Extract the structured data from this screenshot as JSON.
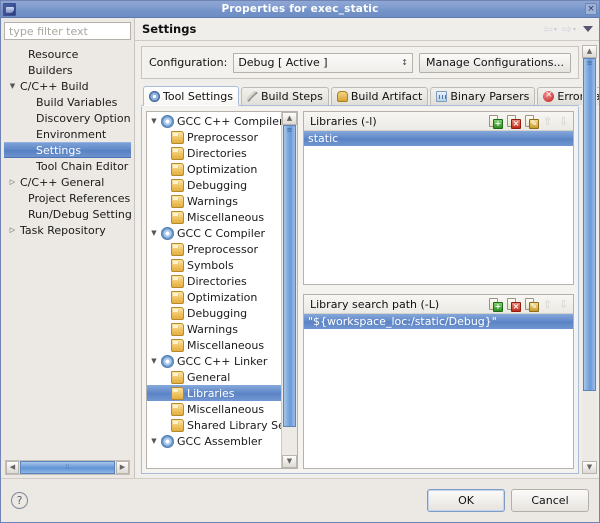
{
  "window": {
    "title": "Properties for exec_static",
    "icon": "eclipse-icon",
    "close_label": "×"
  },
  "sidebar": {
    "filter_placeholder": "type filter text",
    "filter_value": "",
    "items": [
      {
        "label": "Resource",
        "indent": 1,
        "twisty": "",
        "selected": false
      },
      {
        "label": "Builders",
        "indent": 1,
        "twisty": "",
        "selected": false
      },
      {
        "label": "C/C++ Build",
        "indent": 0,
        "twisty": "▼",
        "selected": false
      },
      {
        "label": "Build Variables",
        "indent": 2,
        "twisty": "",
        "selected": false
      },
      {
        "label": "Discovery Options",
        "indent": 2,
        "twisty": "",
        "selected": false
      },
      {
        "label": "Environment",
        "indent": 2,
        "twisty": "",
        "selected": false
      },
      {
        "label": "Settings",
        "indent": 2,
        "twisty": "",
        "selected": true
      },
      {
        "label": "Tool Chain Editor",
        "indent": 2,
        "twisty": "",
        "selected": false
      },
      {
        "label": "C/C++ General",
        "indent": 0,
        "twisty": "▷",
        "selected": false
      },
      {
        "label": "Project References",
        "indent": 1,
        "twisty": "",
        "selected": false
      },
      {
        "label": "Run/Debug Settings",
        "indent": 1,
        "twisty": "",
        "selected": false
      },
      {
        "label": "Task Repository",
        "indent": 0,
        "twisty": "▷",
        "selected": false
      }
    ],
    "hscroll": {
      "left_arrow": "◀",
      "right_arrow": "▶",
      "grip": "∶∶"
    }
  },
  "page": {
    "title": "Settings",
    "back_arrow": "⇦",
    "forward_arrow": "⇨",
    "caret": "▾",
    "menu": "menu-triangle"
  },
  "config": {
    "label": "Configuration:",
    "value": "Debug  [ Active ]",
    "combo_arrows": "↕",
    "manage_button": "Manage Configurations..."
  },
  "tabs": [
    {
      "label": "Tool Settings",
      "icon": "gear-icon",
      "active": true
    },
    {
      "label": "Build Steps",
      "icon": "wrench-icon",
      "active": false
    },
    {
      "label": "Build Artifact",
      "icon": "artifact-icon",
      "active": false
    },
    {
      "label": "Binary Parsers",
      "icon": "binary-icon",
      "active": false
    },
    {
      "label": "Error Parsers",
      "icon": "error-icon",
      "active": false
    }
  ],
  "tool_tree": [
    {
      "label": "GCC C++ Compiler",
      "icon": "compiler-icon",
      "twisty": "▼",
      "indent": 0,
      "selected": false
    },
    {
      "label": "Preprocessor",
      "icon": "folder-icon",
      "twisty": "",
      "indent": 1,
      "selected": false
    },
    {
      "label": "Directories",
      "icon": "folder-icon",
      "twisty": "",
      "indent": 1,
      "selected": false
    },
    {
      "label": "Optimization",
      "icon": "folder-icon",
      "twisty": "",
      "indent": 1,
      "selected": false
    },
    {
      "label": "Debugging",
      "icon": "folder-icon",
      "twisty": "",
      "indent": 1,
      "selected": false
    },
    {
      "label": "Warnings",
      "icon": "folder-icon",
      "twisty": "",
      "indent": 1,
      "selected": false
    },
    {
      "label": "Miscellaneous",
      "icon": "folder-icon",
      "twisty": "",
      "indent": 1,
      "selected": false
    },
    {
      "label": "GCC C Compiler",
      "icon": "compiler-icon",
      "twisty": "▼",
      "indent": 0,
      "selected": false
    },
    {
      "label": "Preprocessor",
      "icon": "folder-icon",
      "twisty": "",
      "indent": 1,
      "selected": false
    },
    {
      "label": "Symbols",
      "icon": "folder-icon",
      "twisty": "",
      "indent": 1,
      "selected": false
    },
    {
      "label": "Directories",
      "icon": "folder-icon",
      "twisty": "",
      "indent": 1,
      "selected": false
    },
    {
      "label": "Optimization",
      "icon": "folder-icon",
      "twisty": "",
      "indent": 1,
      "selected": false
    },
    {
      "label": "Debugging",
      "icon": "folder-icon",
      "twisty": "",
      "indent": 1,
      "selected": false
    },
    {
      "label": "Warnings",
      "icon": "folder-icon",
      "twisty": "",
      "indent": 1,
      "selected": false
    },
    {
      "label": "Miscellaneous",
      "icon": "folder-icon",
      "twisty": "",
      "indent": 1,
      "selected": false
    },
    {
      "label": "GCC C++ Linker",
      "icon": "compiler-icon",
      "twisty": "▼",
      "indent": 0,
      "selected": false
    },
    {
      "label": "General",
      "icon": "folder-icon",
      "twisty": "",
      "indent": 1,
      "selected": false
    },
    {
      "label": "Libraries",
      "icon": "folder-icon",
      "twisty": "",
      "indent": 1,
      "selected": true
    },
    {
      "label": "Miscellaneous",
      "icon": "folder-icon",
      "twisty": "",
      "indent": 1,
      "selected": false
    },
    {
      "label": "Shared Library Settings",
      "icon": "folder-icon",
      "twisty": "",
      "indent": 1,
      "selected": false
    },
    {
      "label": "GCC Assembler",
      "icon": "compiler-icon",
      "twisty": "▼",
      "indent": 0,
      "selected": false
    }
  ],
  "libraries_panel": {
    "title": "Libraries (-l)",
    "items": [
      {
        "label": "static",
        "selected": true
      }
    ],
    "tools": [
      {
        "name": "add-button",
        "badge": "+",
        "kind": "add"
      },
      {
        "name": "delete-button",
        "badge": "×",
        "kind": "del"
      },
      {
        "name": "edit-button",
        "badge": "✎",
        "kind": "edit"
      },
      {
        "name": "move-up-button",
        "glyph": "⇧"
      },
      {
        "name": "move-down-button",
        "glyph": "⇩"
      }
    ]
  },
  "search_path_panel": {
    "title": "Library search path (-L)",
    "items": [
      {
        "label": "\"${workspace_loc:/static/Debug}\"",
        "selected": true
      }
    ],
    "tools": [
      {
        "name": "add-button",
        "badge": "+",
        "kind": "add"
      },
      {
        "name": "delete-button",
        "badge": "×",
        "kind": "del"
      },
      {
        "name": "edit-button",
        "badge": "✎",
        "kind": "edit"
      },
      {
        "name": "move-up-button",
        "glyph": "⇧"
      },
      {
        "name": "move-down-button",
        "glyph": "⇩"
      }
    ]
  },
  "scrollbars": {
    "up_arrow": "▲",
    "down_arrow": "▼",
    "grip": "≡"
  },
  "footer": {
    "help_label": "?",
    "ok_label": "OK",
    "cancel_label": "Cancel"
  }
}
